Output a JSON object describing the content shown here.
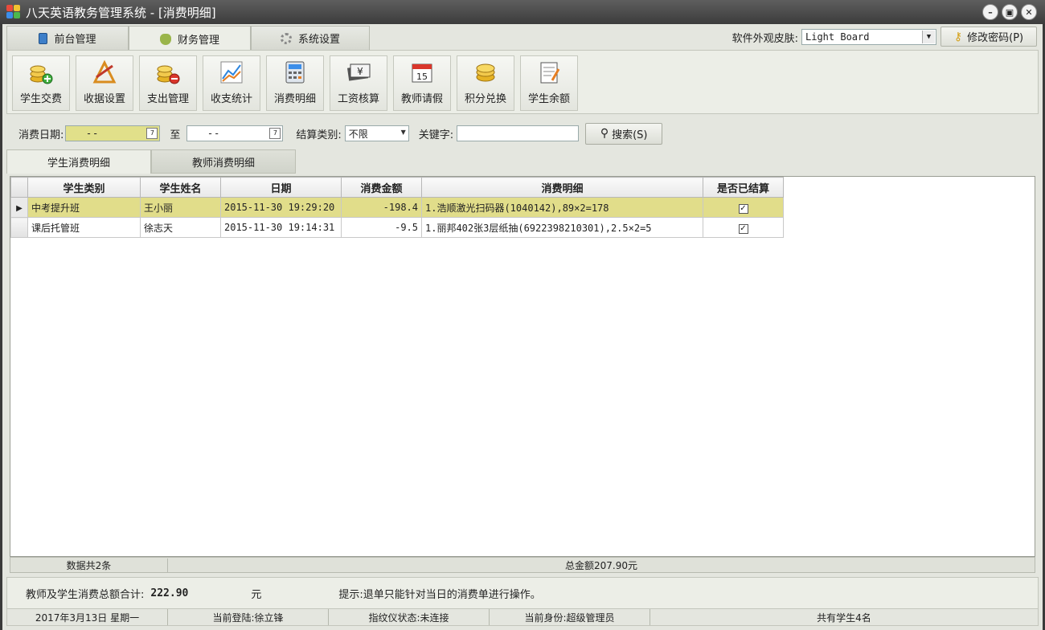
{
  "window": {
    "title": "八天英语教务管理系统 - [消费明细]"
  },
  "top_tabs": [
    {
      "label": "前台管理",
      "icon": "book-icon"
    },
    {
      "label": "财务管理",
      "icon": "money-bag-icon"
    },
    {
      "label": "系统设置",
      "icon": "gear-icon"
    }
  ],
  "skin": {
    "label": "软件外观皮肤:",
    "value": "Light Board"
  },
  "change_password_label": "修改密码(P)",
  "toolbar": [
    {
      "label": "学生交费",
      "icon": "coins-add-icon"
    },
    {
      "label": "收据设置",
      "icon": "ruler-set-icon"
    },
    {
      "label": "支出管理",
      "icon": "coins-remove-icon"
    },
    {
      "label": "收支统计",
      "icon": "line-chart-icon"
    },
    {
      "label": "消费明细",
      "icon": "calculator-icon"
    },
    {
      "label": "工资核算",
      "icon": "yen-note-icon"
    },
    {
      "label": "教师请假",
      "icon": "calendar-icon"
    },
    {
      "label": "积分兑换",
      "icon": "coin-stack-icon"
    },
    {
      "label": "学生余额",
      "icon": "notepad-icon"
    }
  ],
  "filter": {
    "date_label": "消费日期:",
    "date_from": "  -  -",
    "to_label": "至",
    "date_to": "  -  -",
    "settle_label": "结算类别:",
    "settle_value": "不限",
    "keyword_label": "关键字:",
    "keyword_value": "",
    "search_label": "搜索(S)"
  },
  "sub_tabs": [
    "学生消费明细",
    "教师消费明细"
  ],
  "grid": {
    "columns": [
      "学生类别",
      "学生姓名",
      "日期",
      "消费金额",
      "消费明细",
      "是否已结算"
    ],
    "rows": [
      {
        "category": "中考提升班",
        "name": "王小丽",
        "date": "2015-11-30 19:29:20",
        "amount": "-198.4",
        "detail": "1.浩顺激光扫码器(1040142),89×2=178",
        "settled": true
      },
      {
        "category": "课后托管班",
        "name": "徐志天",
        "date": "2015-11-30 19:14:31",
        "amount": "-9.5",
        "detail": "1.丽邦402张3层纸抽(6922398210301),2.5×2=5",
        "settled": true
      }
    ]
  },
  "summary": {
    "count": "数据共2条",
    "total": "总金额207.90元"
  },
  "info": {
    "total_label": "教师及学生消费总额合计:",
    "total_value": "222.90",
    "unit": "元",
    "hint": "提示:退单只能针对当日的消费单进行操作。"
  },
  "status": {
    "date": "2017年3月13日 星期一",
    "login": "当前登陆:徐立锋",
    "fingerprint": "指纹仪状态:未连接",
    "role": "当前身份:超级管理员",
    "students": "共有学生4名"
  }
}
